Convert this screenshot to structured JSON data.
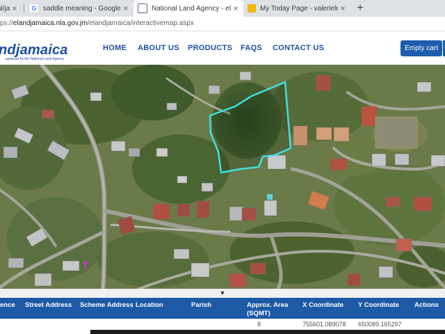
{
  "browser": {
    "tabs": [
      {
        "label": "al/ja",
        "favicon": "globe-icon",
        "active": false
      },
      {
        "label": "saddle meaning - Google Search",
        "favicon": "google-icon",
        "active": false
      },
      {
        "label": "National Land Agency - eLandja",
        "favicon": "page-icon",
        "active": true
      },
      {
        "label": "My Today Page - valerielevyrealtc",
        "favicon": "mytoday-icon",
        "active": false
      }
    ],
    "close_glyph": "×",
    "new_tab_glyph": "+",
    "url_scheme": "ps://",
    "url_host": "elandjamaica.nla.gov.jm",
    "url_path": "/elandjamaica/interactivemap.aspx"
  },
  "site": {
    "logo_text": "ndjamaica",
    "logo_tagline": "powered by the National Land Agency",
    "nav": [
      "HOME",
      "ABOUT US",
      "PRODUCTS",
      "FAQS",
      "CONTACT US"
    ],
    "cart_label": "Empty cart"
  },
  "map": {
    "parcel_outline_color": "#3fe0e0",
    "marker_glyph": "✝",
    "marker_color": "#c03cc8"
  },
  "results": {
    "toggle_glyph": "▼",
    "columns": [
      "ence",
      "Street Address",
      "Scheme Address",
      "Location",
      "Parish",
      "Approx. Area (SQMT)",
      "X Coordinate",
      "Y Coordinate",
      "Actions"
    ],
    "header_color": "#1d5aa6",
    "row": {
      "approx_area": "8",
      "x_coordinate": "755601.089078",
      "y_coordinate": "650089.165297"
    }
  }
}
